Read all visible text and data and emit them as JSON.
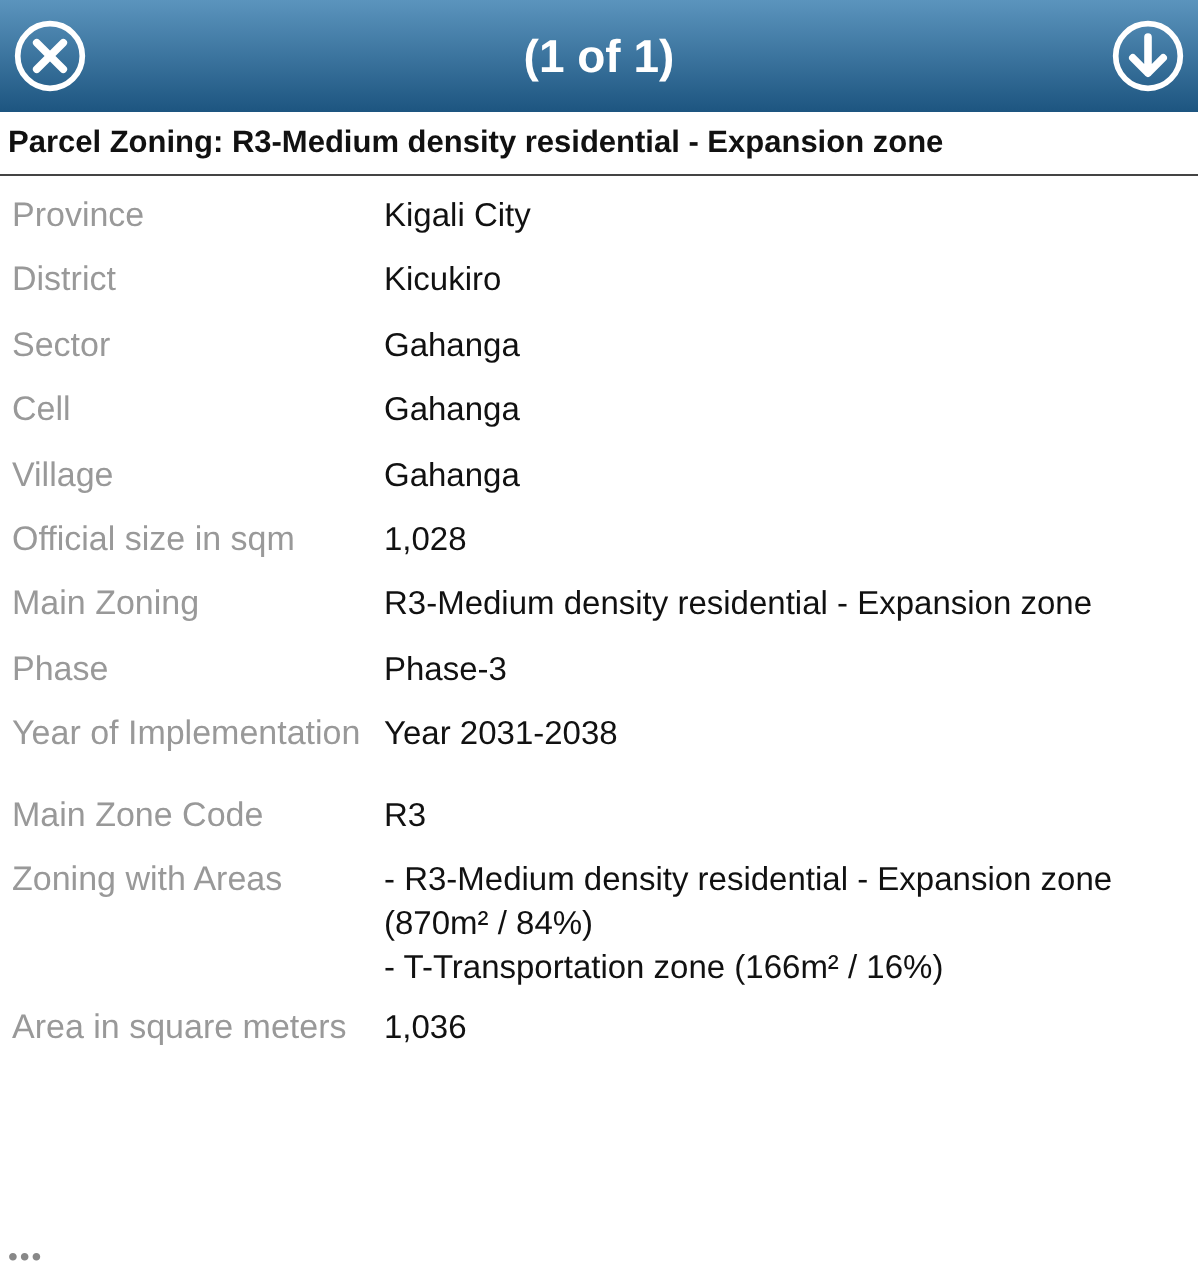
{
  "header": {
    "title": "(1 of 1)"
  },
  "popup_title": "Parcel Zoning: R3-Medium density residential - Expansion zone",
  "fields": [
    {
      "label": "Province",
      "value": [
        "Kigali City"
      ]
    },
    {
      "label": "District",
      "value": [
        "Kicukiro"
      ]
    },
    {
      "label": "Sector",
      "value": [
        "Gahanga"
      ]
    },
    {
      "label": "Cell",
      "value": [
        "Gahanga"
      ]
    },
    {
      "label": "Village",
      "value": [
        "Gahanga"
      ]
    },
    {
      "label": "Official size in sqm",
      "value": [
        "1,028"
      ]
    },
    {
      "label": "Main Zoning",
      "value": [
        "R3-Medium density residential - Expansion zone"
      ]
    },
    {
      "label": "Phase",
      "value": [
        "Phase-3"
      ]
    },
    {
      "label": "Year of Implementation",
      "value": [
        "Year 2031-2038"
      ]
    },
    {
      "label": "Main Zone Code",
      "value": [
        "R3"
      ]
    },
    {
      "label": "Zoning with Areas",
      "value": [
        "- R3-Medium density residential - Expansion zone (870m² / 84%)",
        "- T-Transportation zone (166m² / 16%)"
      ]
    },
    {
      "label": "Area in square meters",
      "value": [
        "1,036"
      ]
    }
  ],
  "more": "•••"
}
